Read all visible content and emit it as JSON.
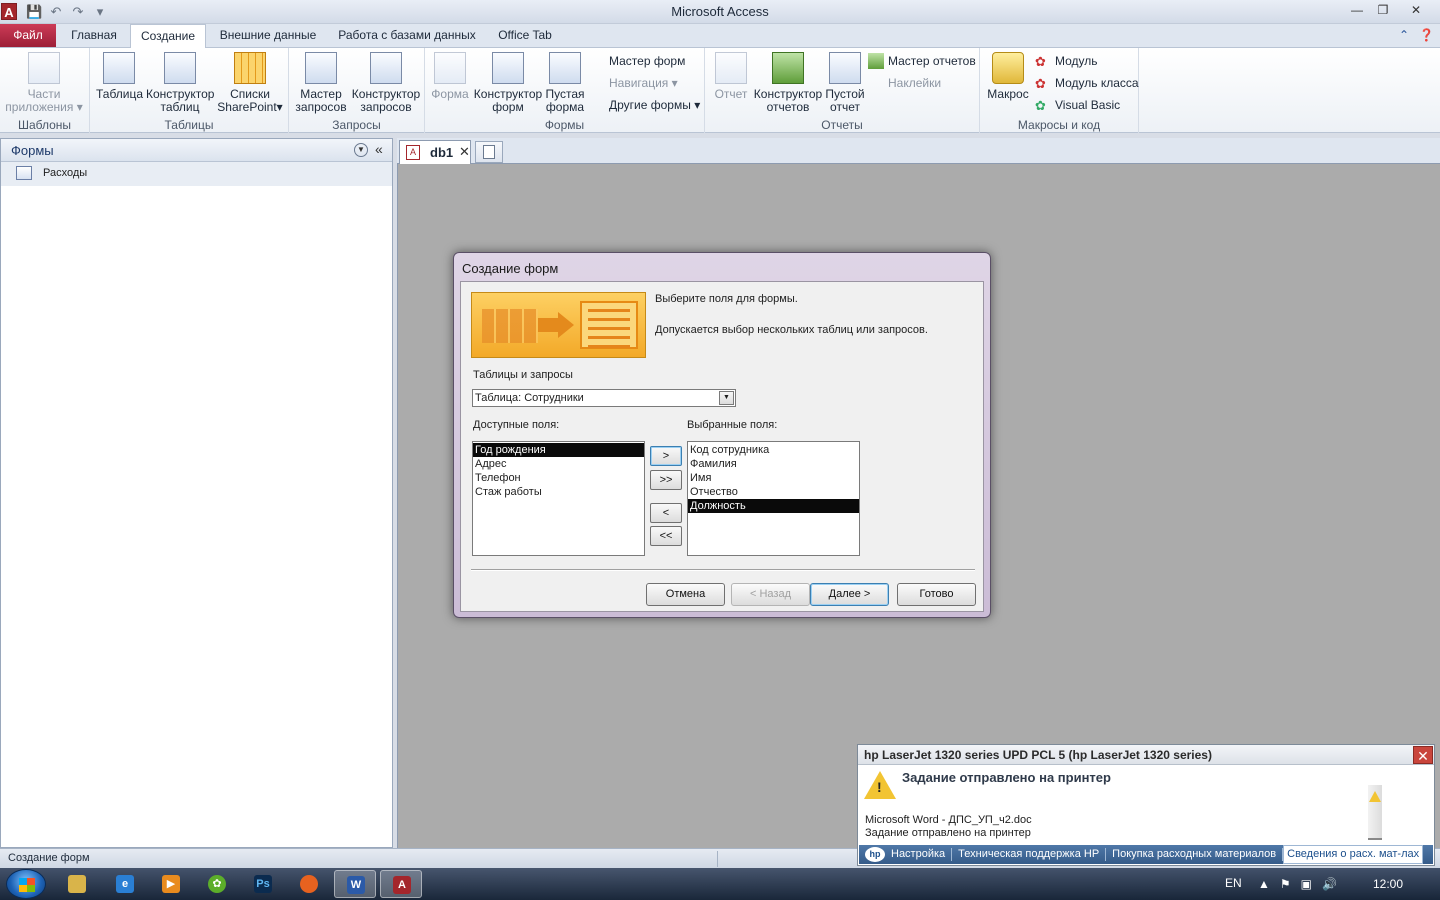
{
  "window": {
    "title": "Microsoft Access",
    "app_icon_letter": "A"
  },
  "ribbon_tabs": {
    "file": "Файл",
    "home": "Главная",
    "create": "Создание",
    "external": "Внешние данные",
    "database_tools": "Работа с базами данных",
    "office_tab": "Office Tab"
  },
  "ribbon": {
    "templates": {
      "label": "Шаблоны",
      "app_parts_l1": "Части",
      "app_parts_l2": "приложения"
    },
    "tables": {
      "label": "Таблицы",
      "table": "Таблица",
      "table_design_l1": "Конструктор",
      "table_design_l2": "таблиц",
      "sp_l1": "Списки",
      "sp_l2": "SharePoint"
    },
    "queries": {
      "label": "Запросы",
      "wizard_l1": "Мастер",
      "wizard_l2": "запросов",
      "design_l1": "Конструктор",
      "design_l2": "запросов"
    },
    "forms": {
      "label": "Формы",
      "form": "Форма",
      "design_l1": "Конструктор",
      "design_l2": "форм",
      "blank_l1": "Пустая",
      "blank_l2": "форма",
      "wizard": "Мастер форм",
      "navigation": "Навигация",
      "more": "Другие формы"
    },
    "reports": {
      "label": "Отчеты",
      "report": "Отчет",
      "design_l1": "Конструктор",
      "design_l2": "отчетов",
      "blank_l1": "Пустой",
      "blank_l2": "отчет",
      "wizard": "Мастер отчетов",
      "labels": "Наклейки"
    },
    "macros": {
      "label": "Макросы и код",
      "macro": "Макрос",
      "module": "Модуль",
      "class_module": "Модуль класса",
      "vb": "Visual Basic"
    }
  },
  "nav_pane": {
    "title": "Формы",
    "items": [
      {
        "label": "Расходы"
      }
    ]
  },
  "doc_tabs": [
    {
      "label": "db1"
    }
  ],
  "dialog": {
    "title": "Создание форм",
    "instruction1": "Выберите поля для формы.",
    "instruction2": "Допускается выбор нескольких таблиц или запросов.",
    "tables_label": "Таблицы и запросы",
    "tables_value": "Таблица: Сотрудники",
    "available_label": "Доступные поля:",
    "selected_label": "Выбранные поля:",
    "available_fields": [
      "Год рождения",
      "Адрес",
      "Телефон",
      "Стаж работы"
    ],
    "selected_fields": [
      "Код сотрудника",
      "Фамилия",
      "Имя",
      "Отчество",
      "Должность"
    ],
    "move_one": ">",
    "move_all": ">>",
    "remove_one": "<",
    "remove_all": "<<",
    "cancel": "Отмена",
    "back": "< Назад",
    "next": "Далее >",
    "finish": "Готово"
  },
  "status_bar": {
    "text": "Создание форм"
  },
  "printer_notice": {
    "title": "hp LaserJet 1320 series UPD PCL 5 (hp LaserJet 1320 series)",
    "message": "Задание отправлено на принтер",
    "line1": "Microsoft Word - ДПС_УП_ч2.doc",
    "line2": "Задание отправлено на принтер",
    "links": [
      "Настройка",
      "Техническая поддержка HP",
      "Покупка расходных материалов",
      "Сведения о расх. мат-лах"
    ]
  },
  "taskbar": {
    "lang": "EN",
    "clock": "12:00"
  }
}
